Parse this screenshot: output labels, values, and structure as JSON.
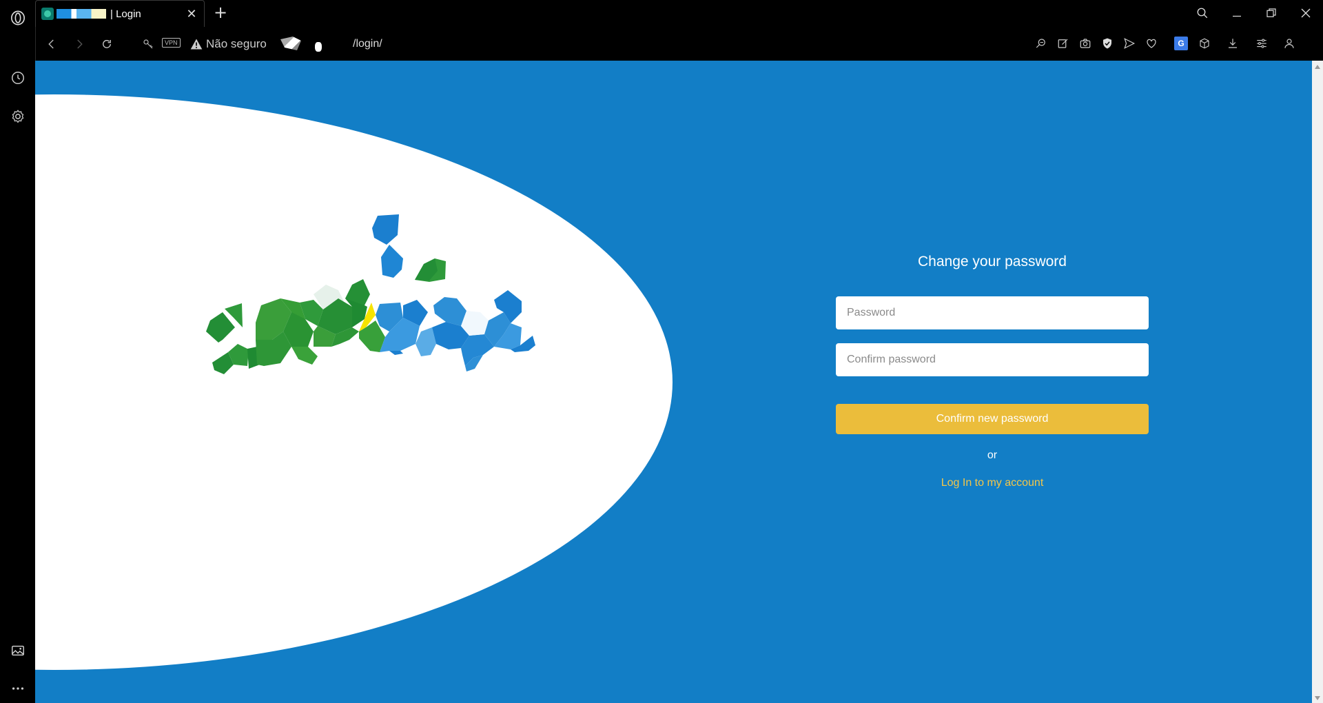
{
  "browser": {
    "tab": {
      "title": "| Login",
      "close_glyph": "✕"
    },
    "new_tab_glyph": "+",
    "address": {
      "vpn_badge": "VPN",
      "security_label": "Não seguro",
      "url_path": "/login/"
    }
  },
  "sidebar": {
    "icons": [
      "opera-logo-icon",
      "history-icon",
      "settings-icon",
      "gallery-icon",
      "more-icon"
    ]
  },
  "toolbar": {
    "icons": [
      "zoom-icon",
      "edit-icon",
      "camera-icon",
      "shield-icon",
      "send-icon",
      "heart-icon",
      "translate-icon",
      "cube-icon",
      "download-icon",
      "easy-setup-icon",
      "profile-icon"
    ],
    "translate_glyph": "G"
  },
  "form": {
    "title": "Change your password",
    "password_placeholder": "Password",
    "confirm_placeholder": "Confirm password",
    "submit_label": "Confirm new password",
    "or_label": "or",
    "login_link": "Log In to my account"
  },
  "colors": {
    "page_background": "#127ec6",
    "button": "#ebbd3b",
    "link": "#f3c649"
  }
}
